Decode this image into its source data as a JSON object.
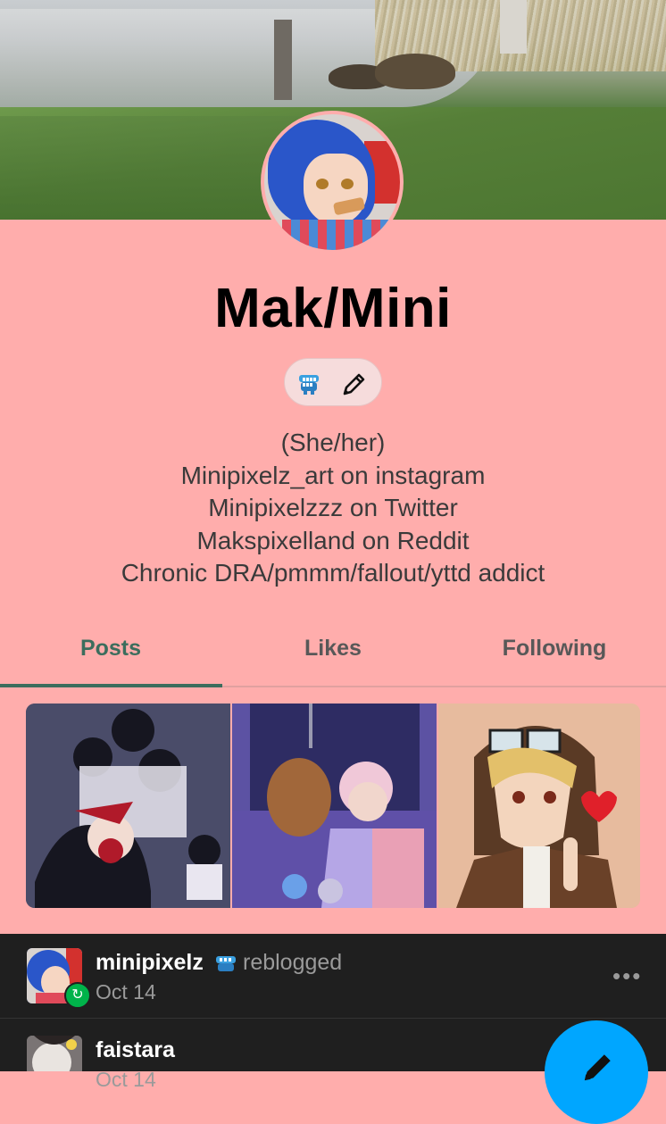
{
  "profile": {
    "name": "Mak/Mini",
    "bio": [
      "(She/her)",
      "Minipixelz_art on instagram",
      "Minipixelzzz on Twitter",
      "Makspixelland on Reddit",
      "Chronic DRA/pmmm/fallout/yttd addict"
    ],
    "badges": [
      "blue-chattering-teeth-icon",
      "pencil-icon"
    ]
  },
  "tabs": [
    {
      "label": "Posts",
      "active": true
    },
    {
      "label": "Likes",
      "active": false
    },
    {
      "label": "Following",
      "active": false
    }
  ],
  "feed": [
    {
      "user": "minipixelz",
      "action": "reblogged",
      "date": "Oct 14"
    },
    {
      "user": "faistara",
      "date": "Oct 14"
    }
  ],
  "colors": {
    "background": "#ffadac",
    "accent": "#3c6d5d",
    "feed_background": "#1f1f1f",
    "fab": "#00a6ff",
    "reblog_green": "#00b34a"
  }
}
